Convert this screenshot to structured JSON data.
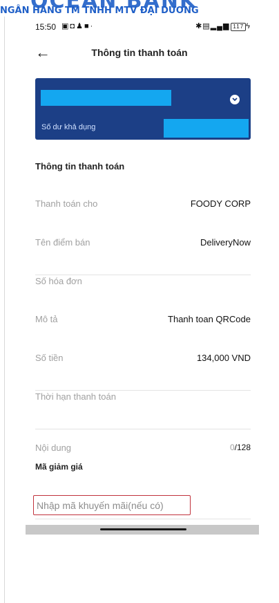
{
  "watermark": {
    "brand": "OCEAN BANK",
    "subtitle": "NGÂN HÀNG TM TNHH MTV ĐẠI DƯƠNG"
  },
  "status_bar": {
    "time": "15:50",
    "battery": "117"
  },
  "header": {
    "title": "Thông tin thanh toán"
  },
  "account_card": {
    "balance_label": "Số dư khả dụng",
    "colors": {
      "background": "#1c3f86",
      "mask": "#14a7f0"
    }
  },
  "payment_info": {
    "section_title": "Thông tin thanh toán",
    "rows": [
      {
        "label": "Thanh toán cho",
        "value": "FOODY CORP"
      },
      {
        "label": "Tên điểm bán",
        "value": "DeliveryNow"
      },
      {
        "label": "Số hóa đơn",
        "value": ""
      },
      {
        "label": "Mô tả",
        "value": "Thanh toan QRCode"
      },
      {
        "label": "Số tiền",
        "value": "134,000 VND"
      },
      {
        "label": "Thời hạn thanh toán",
        "value": ""
      }
    ]
  },
  "content_field": {
    "label": "Nội dung",
    "count_current": "0",
    "count_max": "/128"
  },
  "discount": {
    "title": "Mã giảm giá",
    "placeholder": "Nhập mã khuyến mãi(nếu có)"
  },
  "colors": {
    "highlight_border": "#c0313b",
    "watermark": "#1f5fc7"
  }
}
